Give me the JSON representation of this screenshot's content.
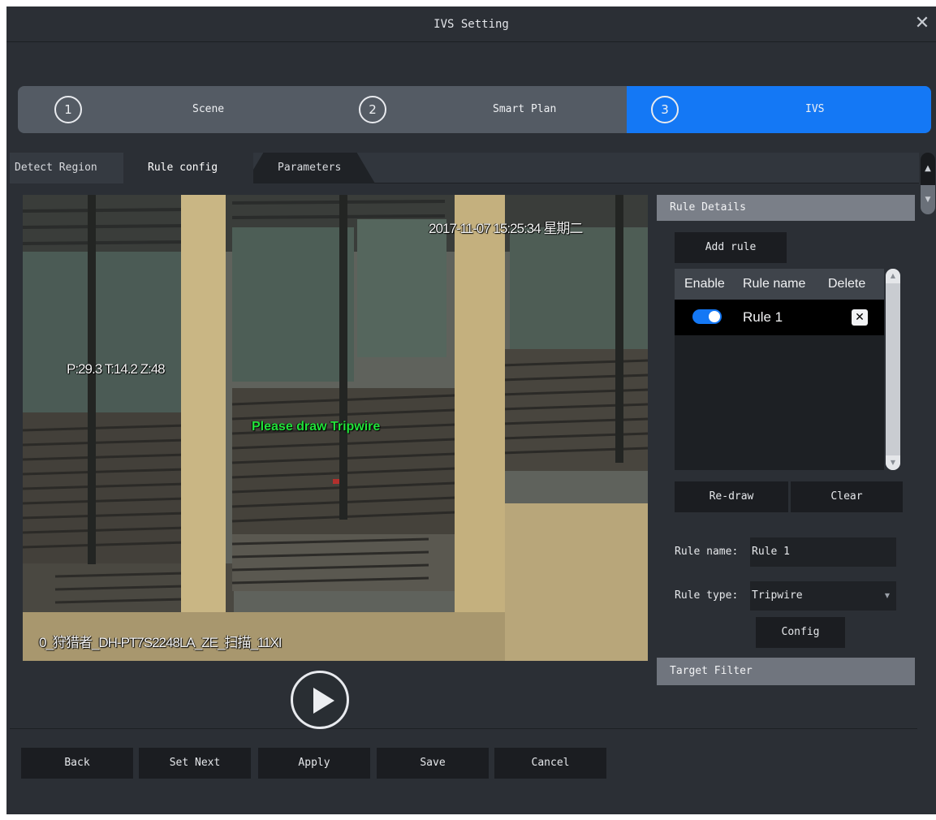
{
  "dialog": {
    "title": "IVS Setting",
    "close_icon": "close-icon"
  },
  "steps": [
    {
      "number": "1",
      "label": "Scene",
      "active": false
    },
    {
      "number": "2",
      "label": "Smart Plan",
      "active": false
    },
    {
      "number": "3",
      "label": "IVS",
      "active": true
    }
  ],
  "tabs": [
    {
      "label": "Detect Region",
      "active": false
    },
    {
      "label": "Rule config",
      "active": true
    },
    {
      "label": "Parameters",
      "active": false
    }
  ],
  "video": {
    "timestamp": "2017-11-07 15:25:34 星期二",
    "ptz_info": "P:29.3 T:14.2 Z:48",
    "channel_name": "0_狩猎者_DH-PT7S2248LA_ZE_扫描_11XI",
    "prompt": "Please draw Tripwire",
    "play_icon": "play-icon"
  },
  "rule_panel": {
    "header": "Rule Details",
    "add_rule_label": "Add rule",
    "table": {
      "columns": [
        "Enable",
        "Rule name",
        "Delete"
      ],
      "rows": [
        {
          "enabled": true,
          "name": "Rule 1",
          "delete_icon": "delete-x-icon"
        }
      ]
    },
    "redraw_label": "Re-draw",
    "clear_label": "Clear",
    "rule_name_label": "Rule name:",
    "rule_name_value": "Rule 1",
    "rule_type_label": "Rule type:",
    "rule_type_value": "Tripwire",
    "config_label": "Config",
    "target_filter_header": "Target Filter"
  },
  "footer": {
    "back": "Back",
    "set_next": "Set Next",
    "apply": "Apply",
    "save": "Save",
    "cancel": "Cancel"
  },
  "colors": {
    "accent": "#1478f5",
    "dialog_bg": "#2b2f35",
    "prompt_text": "#22e23a"
  }
}
